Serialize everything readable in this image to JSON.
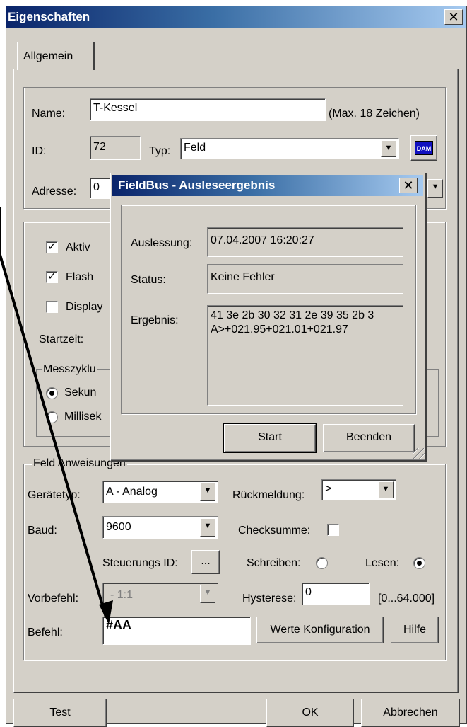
{
  "main_dialog": {
    "title": "Eigenschaften",
    "close_glyph": "✕",
    "tab_general": "Allgemein",
    "name_label": "Name:",
    "name_value": "T-Kessel",
    "name_hint": "(Max. 18 Zeichen)",
    "id_label": "ID:",
    "id_value": "72",
    "type_label": "Typ:",
    "type_value": "Feld",
    "dam_icon_text": "DAM",
    "address_label": "Adresse:",
    "address_value": "0",
    "active_label": "Aktiv",
    "active_checked": "✓",
    "flash_label": "Flash",
    "flash_checked": "✓",
    "display_label": "Display",
    "start_time_label": "Startzeit:",
    "measure_cycle_label": "Messzyklu",
    "seconds_label": "Sekun",
    "milliseconds_label": "Millisek"
  },
  "field_instructions": {
    "group_title": "Feld Anweisungen",
    "device_type_label": "Gerätetyp:",
    "device_type_value": "A - Analog",
    "feedback_label": "Rückmeldung:",
    "feedback_value": ">",
    "baud_label": "Baud:",
    "baud_value": "9600",
    "checksum_label": "Checksumme:",
    "control_id_label": "Steuerungs ID:",
    "control_id_button": "...",
    "write_label": "Schreiben:",
    "read_label": "Lesen:",
    "precommand_label": "Vorbefehl:",
    "precommand_value": "- 1:1",
    "hysteresis_label": "Hysterese:",
    "hysteresis_value": "0",
    "hysteresis_range": "[0...64.000]",
    "command_label": "Befehl:",
    "command_value": "#AA",
    "values_config_button": "Werte Konfiguration",
    "help_button": "Hilfe"
  },
  "bottom_buttons": {
    "test": "Test",
    "ok": "OK",
    "cancel": "Abbrechen"
  },
  "popup": {
    "title": "FieldBus - Ausleseergebnis",
    "close_glyph": "✕",
    "readout_label": "Auslessung:",
    "readout_value": "07.04.2007 16:20:27",
    "status_label": "Status:",
    "status_value": "Keine Fehler",
    "result_label": "Ergebnis:",
    "result_line1": "41 3e 2b 30 32 31 2e 39 35 2b 3",
    "result_line2": "A>+021.95+021.01+021.97",
    "start_button": "Start",
    "close_button": "Beenden"
  },
  "colors": {
    "dialog_bg": "#d4d0c8",
    "title_active_start": "#0a246a",
    "title_active_end": "#a6caf0",
    "annotation_arrow": "#000000"
  }
}
